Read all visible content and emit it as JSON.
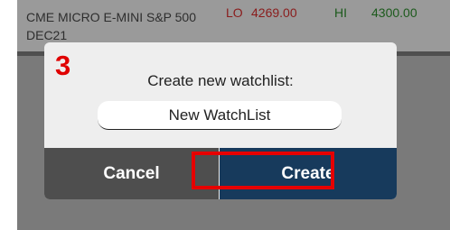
{
  "quote": {
    "instrument_line1": "CME MICRO E-MINI S&P 500",
    "instrument_line2": "DEC21",
    "lo_label": "LO",
    "lo_value": "4269.00",
    "hi_label": "HI",
    "hi_value": "4300.00"
  },
  "dialog": {
    "step_number": "3",
    "title": "Create new watchlist:",
    "input_value": "New WatchList",
    "cancel_label": "Cancel",
    "create_label": "Create"
  },
  "colors": {
    "lo": "#8a1c1c",
    "hi": "#1c5a1c",
    "create_button": "#173a5c",
    "cancel_button": "#4e4e4e",
    "highlight": "#e60000",
    "step_number": "#e00000"
  }
}
